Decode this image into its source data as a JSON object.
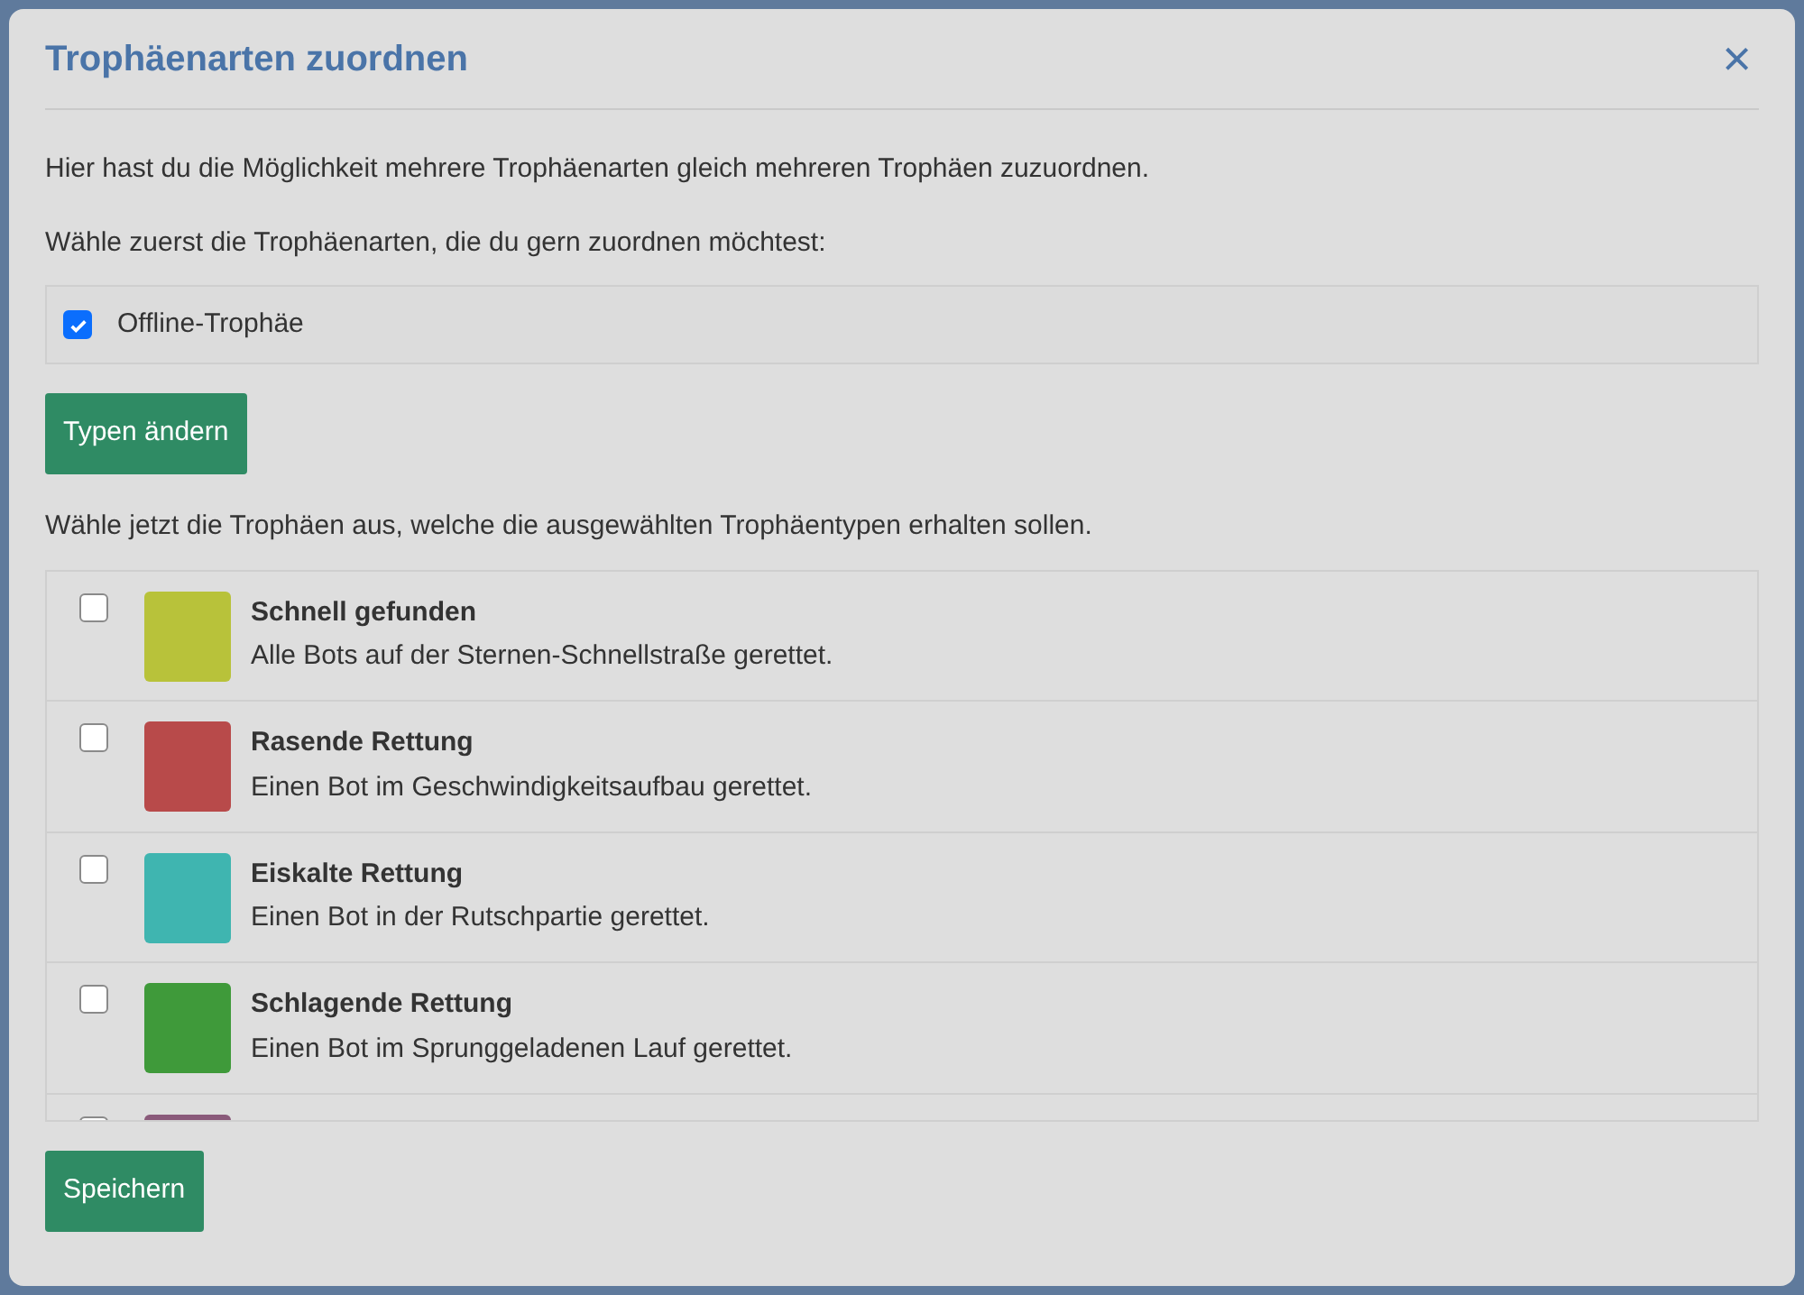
{
  "dialog": {
    "title": "Trophäenarten zuordnen",
    "close": "×"
  },
  "intro": "Hier hast du die Möglichkeit mehrere Trophäenarten gleich mehreren Trophäen zuzuordnen.",
  "type_prompt": "Wähle zuerst die Trophäenarten, die du gern zuordnen möchtest:",
  "types": [
    {
      "label": "Offline-Trophäe",
      "checked": true
    }
  ],
  "change_button": "Typen ändern",
  "trophy_prompt": "Wähle jetzt die Trophäen aus, welche die ausgewählten Trophäentypen erhalten sollen.",
  "trophies": [
    {
      "title": "Schnell gefunden",
      "description": "Alle Bots auf der Sternen-Schnellstraße gerettet.",
      "checked": false,
      "color": "#b8c23a"
    },
    {
      "title": "Rasende Rettung",
      "description": "Einen Bot im Geschwindigkeitsaufbau gerettet.",
      "checked": false,
      "color": "#b84a4a"
    },
    {
      "title": "Eiskalte Rettung",
      "description": "Einen Bot in der Rutschpartie gerettet.",
      "checked": false,
      "color": "#3fb5b0"
    },
    {
      "title": "Schlagende Rettung",
      "description": "Einen Bot im Sprunggeladenen Lauf gerettet.",
      "checked": false,
      "color": "#3f9a3a"
    },
    {
      "checked": false,
      "color": "#8a5a7a"
    }
  ],
  "save_button": "Speichern"
}
